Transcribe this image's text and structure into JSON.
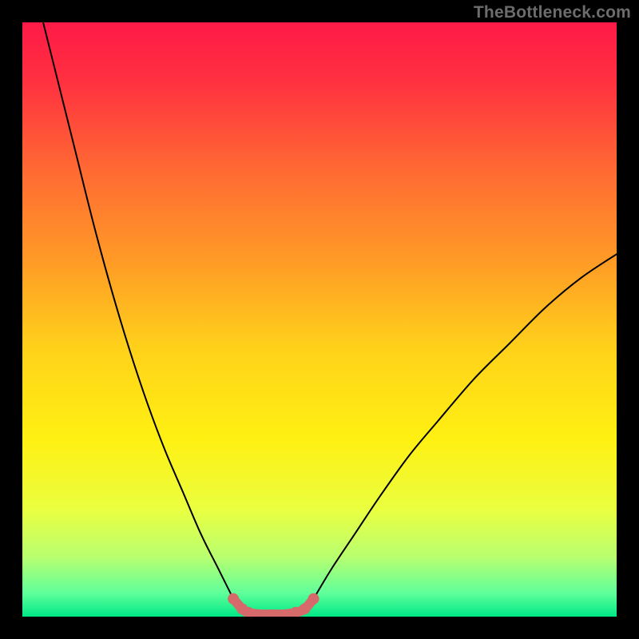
{
  "attribution": "TheBottleneck.com",
  "chart_data": {
    "type": "line",
    "title": "",
    "xlabel": "",
    "ylabel": "",
    "xlim": [
      0,
      100
    ],
    "ylim": [
      0,
      100
    ],
    "background_gradient_stops": [
      {
        "offset": 0.0,
        "color": "#ff1a47"
      },
      {
        "offset": 0.1,
        "color": "#ff3140"
      },
      {
        "offset": 0.25,
        "color": "#ff6a33"
      },
      {
        "offset": 0.4,
        "color": "#ff9a26"
      },
      {
        "offset": 0.55,
        "color": "#ffd21a"
      },
      {
        "offset": 0.7,
        "color": "#fff012"
      },
      {
        "offset": 0.82,
        "color": "#eaff40"
      },
      {
        "offset": 0.9,
        "color": "#b8ff70"
      },
      {
        "offset": 0.96,
        "color": "#60ff9a"
      },
      {
        "offset": 1.0,
        "color": "#00e887"
      }
    ],
    "series": [
      {
        "name": "left-arm",
        "color": "#000000",
        "width": 2,
        "x": [
          3.5,
          6,
          9,
          12,
          15,
          18,
          21,
          24,
          27,
          30,
          33,
          35.5
        ],
        "y": [
          100,
          90,
          78,
          66,
          55,
          45,
          36,
          28,
          21,
          14,
          8,
          3
        ]
      },
      {
        "name": "right-arm",
        "color": "#000000",
        "width": 2,
        "x": [
          49,
          52,
          56,
          60,
          65,
          70,
          76,
          82,
          88,
          94,
          100
        ],
        "y": [
          3,
          8,
          14,
          20,
          27,
          33,
          40,
          46,
          52,
          57,
          61
        ]
      },
      {
        "name": "valley-floor",
        "color": "#d66a6a",
        "width": 12,
        "x": [
          35.5,
          37,
          38,
          40,
          42,
          44,
          46,
          47.5,
          49
        ],
        "y": [
          3,
          1.3,
          0.7,
          0.4,
          0.4,
          0.4,
          0.7,
          1.3,
          3
        ]
      }
    ],
    "markers": [
      {
        "series": "valley-floor",
        "x": 35.5,
        "y": 3,
        "r": 7,
        "color": "#d66a6a"
      },
      {
        "series": "valley-floor",
        "x": 37,
        "y": 1.3,
        "r": 7,
        "color": "#d66a6a"
      },
      {
        "series": "valley-floor",
        "x": 38,
        "y": 0.7,
        "r": 7,
        "color": "#d66a6a"
      },
      {
        "series": "valley-floor",
        "x": 46,
        "y": 0.7,
        "r": 7,
        "color": "#d66a6a"
      },
      {
        "series": "valley-floor",
        "x": 47.5,
        "y": 1.3,
        "r": 7,
        "color": "#d66a6a"
      },
      {
        "series": "valley-floor",
        "x": 49,
        "y": 3,
        "r": 7,
        "color": "#d66a6a"
      }
    ]
  }
}
